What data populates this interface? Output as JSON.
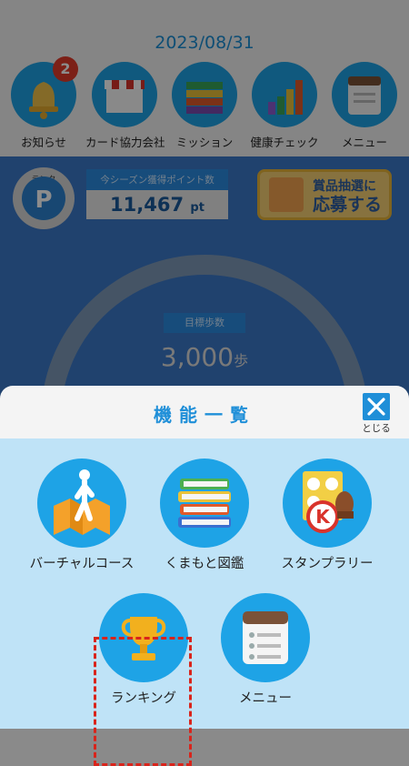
{
  "header": {
    "date": "2023/08/31"
  },
  "top_nav": [
    {
      "label": "お知らせ",
      "icon": "bell-icon",
      "badge": "2"
    },
    {
      "label": "カード協力会社",
      "icon": "shop-icon"
    },
    {
      "label": "ミッション",
      "icon": "books-stack-icon"
    },
    {
      "label": "健康チェック",
      "icon": "bar-chart-icon"
    },
    {
      "label": "メニュー",
      "icon": "notepad-icon"
    }
  ],
  "hero": {
    "rank_tag": "ランク",
    "rank_letter": "P",
    "points_title": "今シーズン獲得ポイント数",
    "points_value": "11,467",
    "points_unit": "pt",
    "prize_line1": "賞品抽選に",
    "prize_line2": "応募する",
    "goal_label": "目標歩数",
    "goal_value": "3,000",
    "goal_unit": "歩"
  },
  "modal": {
    "title": "機能一覧",
    "close_label": "とじる",
    "tiles": [
      {
        "label": "バーチャルコース",
        "icon": "map-walker-icon"
      },
      {
        "label": "くまもと図鑑",
        "icon": "books-icon"
      },
      {
        "label": "スタンプラリー",
        "icon": "stamp-icon"
      },
      {
        "label": "ランキング",
        "icon": "trophy-icon"
      },
      {
        "label": "メニュー",
        "icon": "menu-notepad-icon"
      }
    ]
  },
  "colors": {
    "accent": "#1f8fd8",
    "circle": "#1ea3e6",
    "panel": "#bfe3f7",
    "highlight": "#d9241b",
    "badge": "#e23b2a"
  }
}
